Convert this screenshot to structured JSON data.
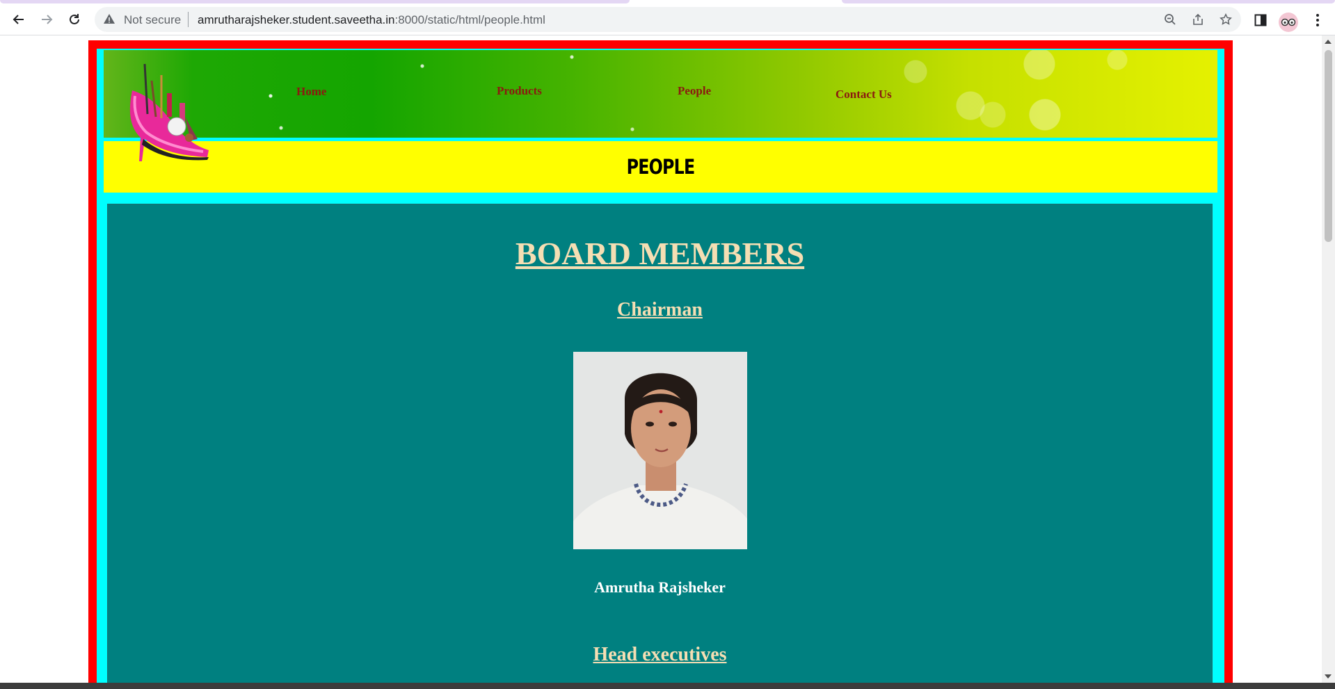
{
  "browser": {
    "security_label": "Not secure",
    "url_host": "amrutharajsheker.student.saveetha.in",
    "url_path": ":8000/static/html/people.html"
  },
  "site": {
    "nav": [
      "Home",
      "Products",
      "People",
      "Contact Us"
    ],
    "page_title": "PEOPLE",
    "colors": {
      "outer_border": "#ff0000",
      "inner_frame": "#00ffff",
      "title_bar": "#ffff00",
      "content_bg": "#008080",
      "heading": "#f5deb3",
      "nav_text": "#8b1a10"
    }
  },
  "board": {
    "heading": "BOARD MEMBERS",
    "chairman_heading": "Chairman",
    "chairman_name": "Amrutha Rajsheker",
    "executives_heading": "Head executives"
  }
}
